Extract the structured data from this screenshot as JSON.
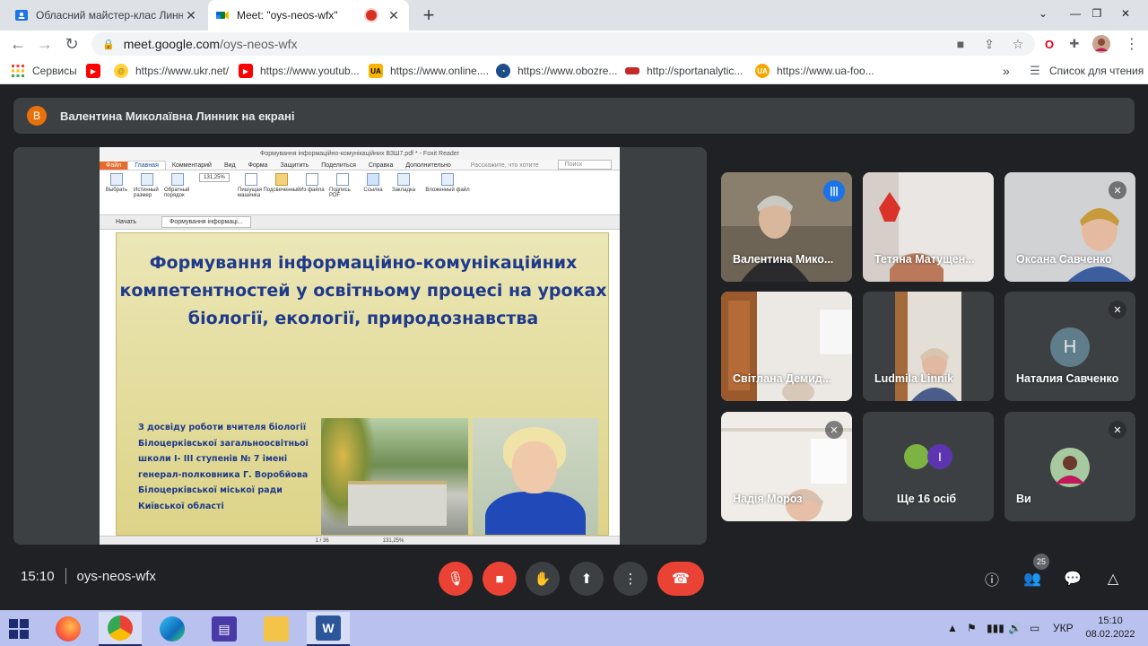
{
  "browser": {
    "tabs": [
      {
        "title": "Обласний майстер-клас Линник",
        "active": false
      },
      {
        "title": "Meet: \"oys-neos-wfx\"",
        "active": true
      }
    ],
    "url_host": "meet.google.com",
    "url_path": "/oys-neos-wfx",
    "bookmarks": [
      "Сервисы",
      "https://www.ukr.net/",
      "https://www.youtub...",
      "https://www.online....",
      "https://www.obozre...",
      "http://sportanalytic...",
      "https://www.ua-foo..."
    ],
    "reading_list": "Список для чтения",
    "overflow": "»"
  },
  "meet": {
    "presenter_initial": "В",
    "presenter_banner": "Валентина Миколаївна Линник на екрані",
    "shared_screen": {
      "window_title": "Формування інформаційно-комунікаційних  ВЗШ7.pdf * - Foxit Reader",
      "ribbon_tabs": [
        "Файл",
        "Главная",
        "Комментарий",
        "Вид",
        "Форма",
        "Защитить",
        "Поделиться",
        "Справка",
        "Дополнительно"
      ],
      "active_ribbon_tab": "Главная",
      "search_hint": "Расскажите, что хотите",
      "search_placeholder": "Поиск",
      "ribbon_buttons": [
        "Выбрать",
        "Истинный размер",
        "Обратный порядок",
        "Пишущая машинка",
        "Подсвеченный",
        "Из файла",
        "Подпись PDF",
        "Ссылка",
        "Закладка",
        "Вложенный файл"
      ],
      "zoom": "131,25%",
      "doc_tabs": [
        "Начать",
        "Формування інформаці..."
      ],
      "slide_title": "Формування інформаційно-комунікаційних компетентностей у освітньому процесі на уроках біології, екології, природознавства",
      "slide_body": "З досвіду роботи вчителя біології Білоцерківської загальноосвітньої школи І- ІІІ ступенів № 7 імені генерал-полковника Г. Воробйова Білоцерківської міської ради Київської області",
      "page_indicator": "1 / 36",
      "status_zoom": "131,25%"
    },
    "participants": [
      {
        "name": "Валентина Мико...",
        "muted": false,
        "speaking": true
      },
      {
        "name": "Тетяна Матущен...",
        "muted": false,
        "speaking": false
      },
      {
        "name": "Оксана Савченко",
        "muted": true,
        "speaking": false
      },
      {
        "name": "Світлана Демид...",
        "muted": false,
        "speaking": false
      },
      {
        "name": "Ludmila Linnik",
        "muted": false,
        "speaking": false
      },
      {
        "name": "Наталия Савченко",
        "muted": true,
        "speaking": false,
        "initial": "Н"
      },
      {
        "name": "Надія Мороз",
        "muted": true,
        "speaking": false
      },
      {
        "name": "Ще 16 осіб",
        "muted": false,
        "speaking": false,
        "initial": "І"
      },
      {
        "name": "Ви",
        "muted": true,
        "speaking": false
      }
    ],
    "time": "15:10",
    "meeting_code": "oys-neos-wfx",
    "participant_count": "25"
  },
  "taskbar": {
    "language": "УКР",
    "time": "15:10",
    "date": "08.02.2022"
  }
}
